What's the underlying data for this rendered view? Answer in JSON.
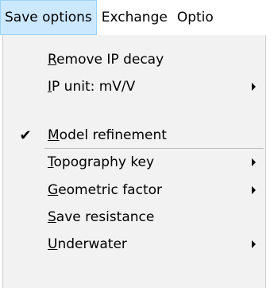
{
  "menubar": {
    "items": [
      {
        "label": "Save options"
      },
      {
        "label": "Exchange"
      },
      {
        "label": "Optio"
      }
    ]
  },
  "menu": {
    "items": [
      {
        "mnemonic": "R",
        "rest": "emove IP decay",
        "checked": false,
        "submenu": false
      },
      {
        "mnemonic": "I",
        "rest": "P unit: mV/V",
        "checked": false,
        "submenu": true
      },
      {
        "mnemonic": "M",
        "rest": "odel refinement",
        "checked": true,
        "submenu": false
      },
      {
        "mnemonic": "T",
        "rest": "opography key",
        "checked": false,
        "submenu": true
      },
      {
        "mnemonic": "G",
        "rest": "eometric factor",
        "checked": false,
        "submenu": true
      },
      {
        "mnemonic": "S",
        "rest": "ave resistance",
        "checked": false,
        "submenu": false
      },
      {
        "mnemonic": "U",
        "rest": "nderwater",
        "checked": false,
        "submenu": true
      }
    ],
    "check_glyph": "✔"
  },
  "colors": {
    "active_menu_bg": "#cce8ff",
    "active_menu_border": "#99d1ff",
    "dropdown_bg": "#f2f2f2"
  }
}
